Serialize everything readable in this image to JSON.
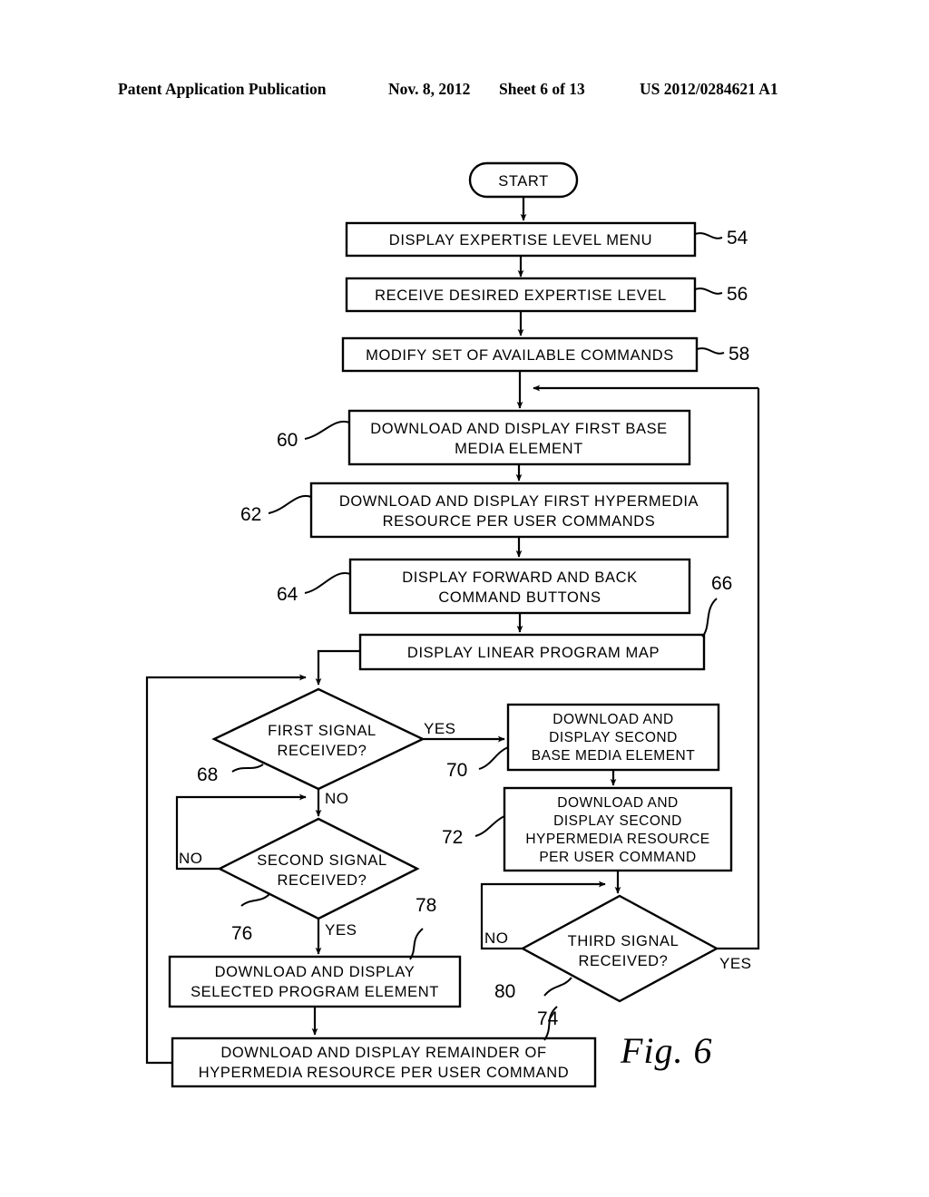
{
  "header": {
    "publication": "Patent Application Publication",
    "date": "Nov. 8, 2012",
    "sheet": "Sheet 6 of 13",
    "pub_number": "US 2012/0284621 A1"
  },
  "figure": {
    "label": "Fig. 6"
  },
  "flowchart": {
    "start": {
      "label": "START"
    },
    "nodes": [
      {
        "ref": "54",
        "line1": "DISPLAY  EXPERTISE  LEVEL  MENU",
        "line2": "",
        "line3": "",
        "line4": ""
      },
      {
        "ref": "56",
        "line1": "RECEIVE  DESIRED  EXPERTISE  LEVEL",
        "line2": "",
        "line3": "",
        "line4": ""
      },
      {
        "ref": "58",
        "line1": "MODIFY  SET  OF  AVAILABLE  COMMANDS",
        "line2": "",
        "line3": "",
        "line4": ""
      },
      {
        "ref": "60",
        "line1": "DOWNLOAD AND DISPLAY FIRST BASE",
        "line2": "MEDIA  ELEMENT",
        "line3": "",
        "line4": ""
      },
      {
        "ref": "62",
        "line1": "DOWNLOAD  AND  DISPLAY  FIRST  HYPERMEDIA",
        "line2": "RESOURCE  PER  USER  COMMANDS",
        "line3": "",
        "line4": ""
      },
      {
        "ref": "64",
        "line1": "DISPLAY  FORWARD  AND  BACK",
        "line2": "COMMAND  BUTTONS",
        "line3": "",
        "line4": ""
      },
      {
        "ref": "66",
        "line1": "DISPLAY  LINEAR  PROGRAM  MAP",
        "line2": "",
        "line3": "",
        "line4": ""
      },
      {
        "ref": "70",
        "line1": "DOWNLOAD  AND",
        "line2": "DISPLAY  SECOND",
        "line3": "BASE MEDIA ELEMENT",
        "line4": ""
      },
      {
        "ref": "72",
        "line1": "DOWNLOAD  AND",
        "line2": "DISPLAY  SECOND",
        "line3": "HYPERMEDIA RESOURCE",
        "line4": "PER  USER  COMMAND"
      },
      {
        "ref": "78",
        "line1": "DOWNLOAD  AND  DISPLAY",
        "line2": "SELECTED  PROGRAM  ELEMENT",
        "line3": "",
        "line4": ""
      },
      {
        "ref": "80",
        "line1": "DOWNLOAD  AND  DISPLAY  REMAINDER  OF",
        "line2": "HYPERMEDIA  RESOURCE  PER  USER  COMMAND",
        "line3": "",
        "line4": ""
      }
    ],
    "decisions": [
      {
        "ref": "68",
        "line1": "FIRST  SIGNAL",
        "line2": "RECEIVED?",
        "yes": "YES",
        "no": "NO"
      },
      {
        "ref": "76",
        "line1": "SECOND  SIGNAL",
        "line2": "RECEIVED?",
        "yes": "YES",
        "no": "NO"
      },
      {
        "ref": "74",
        "line1": "THIRD  SIGNAL",
        "line2": "RECEIVED?",
        "yes": "YES",
        "no": "NO"
      }
    ]
  }
}
